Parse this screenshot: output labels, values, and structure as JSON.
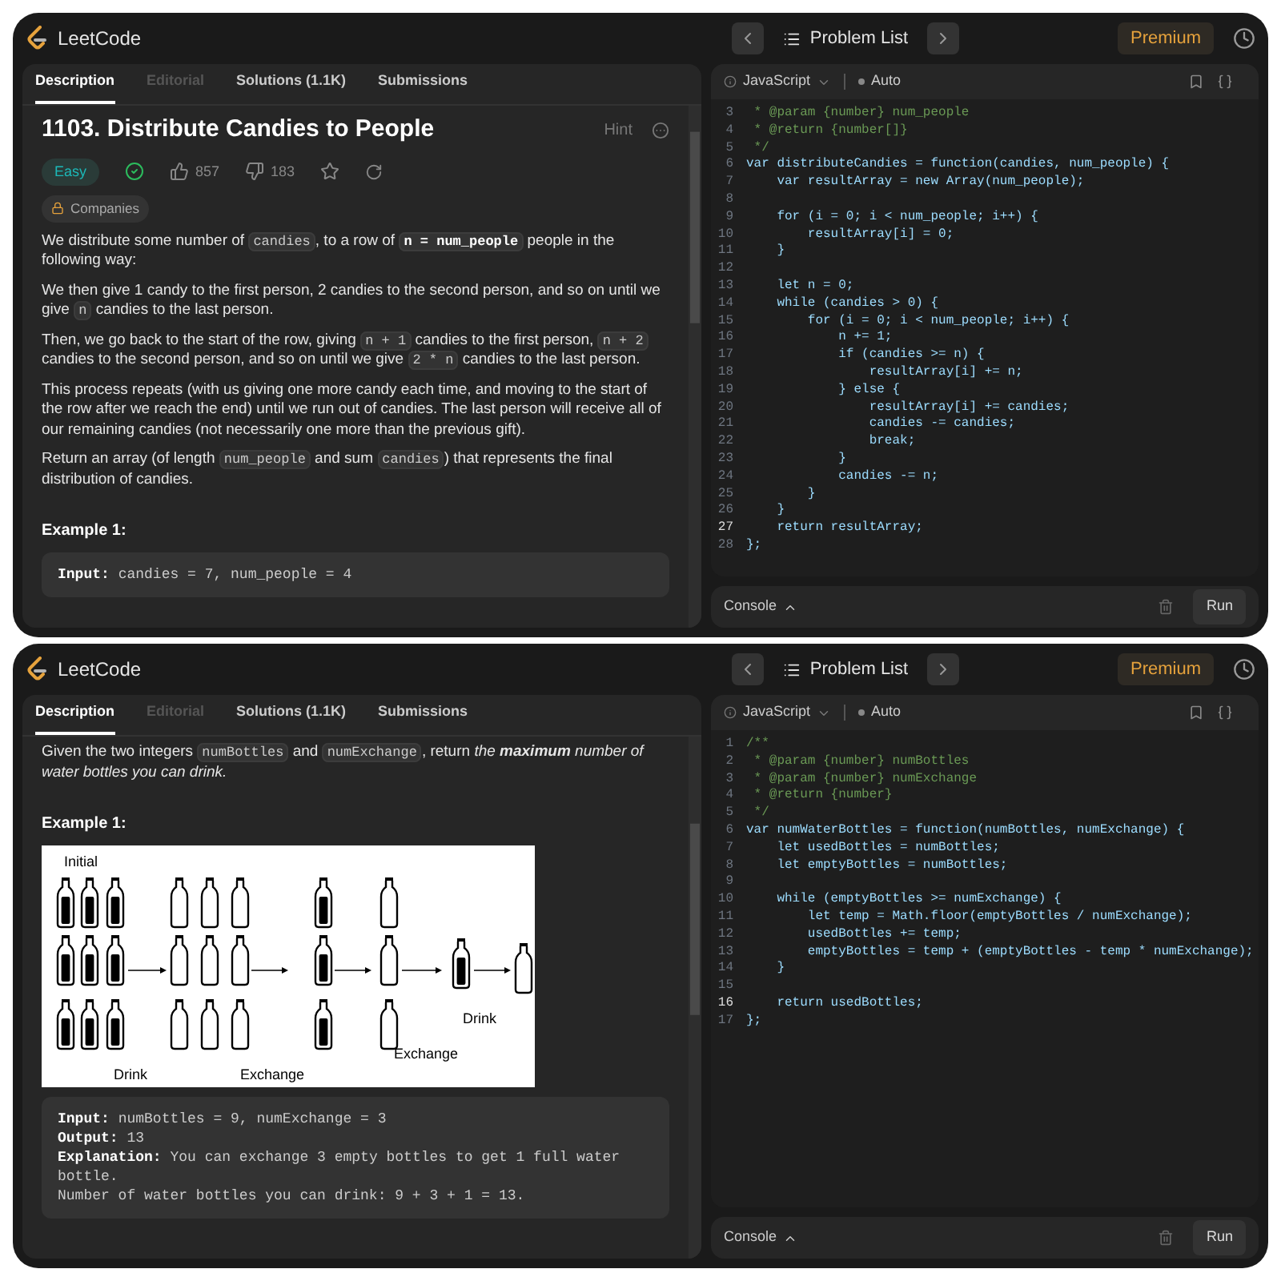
{
  "windows": [
    {
      "header": {
        "logo": "LeetCode",
        "problem_list": "Problem List",
        "premium": "Premium"
      },
      "tabs": [
        {
          "label": "Description",
          "selected": true,
          "disabled": false
        },
        {
          "label": "Editorial",
          "selected": false,
          "disabled": true
        },
        {
          "label": "Solutions (1.1K)",
          "selected": false,
          "disabled": false
        },
        {
          "label": "Submissions",
          "selected": false,
          "disabled": false
        }
      ],
      "problem": {
        "title": "1103. Distribute Candies to People",
        "hint": "Hint",
        "difficulty": "Easy",
        "solved": true,
        "likes": "857",
        "dislikes": "183",
        "companies": "Companies"
      },
      "description": [
        {
          "kind": "paragraph",
          "segments": [
            {
              "kind": "text",
              "text": "We distribute some number of "
            },
            {
              "kind": "code",
              "text": "candies"
            },
            {
              "kind": "text",
              "text": ", to a row of "
            },
            {
              "kind": "strongcode",
              "text": "n = num_people"
            },
            {
              "kind": "text",
              "text": " people in the following way:"
            }
          ]
        },
        {
          "kind": "paragraph",
          "segments": [
            {
              "kind": "text",
              "text": "We then give 1 candy to the first person, 2 candies to the second person, and so on until we give "
            },
            {
              "kind": "code",
              "text": "n"
            },
            {
              "kind": "text",
              "text": " candies to the last person."
            }
          ]
        },
        {
          "kind": "paragraph",
          "segments": [
            {
              "kind": "text",
              "text": "Then, we go back to the start of the row, giving "
            },
            {
              "kind": "code",
              "text": "n + 1"
            },
            {
              "kind": "text",
              "text": " candies to the first person, "
            },
            {
              "kind": "code",
              "text": "n + 2"
            },
            {
              "kind": "text",
              "text": " candies to the second person, and so on until we give "
            },
            {
              "kind": "code",
              "text": "2 * n"
            },
            {
              "kind": "text",
              "text": " candies to the last person."
            }
          ]
        },
        {
          "kind": "paragraph",
          "segments": [
            {
              "kind": "text",
              "text": "This process repeats (with us giving one more candy each time, and moving to the start of the row after we reach the end) until we run out of candies.  The last person will receive all of our remaining candies (not necessarily one more than the previous gift)."
            }
          ]
        },
        {
          "kind": "paragraph",
          "segments": [
            {
              "kind": "text",
              "text": "Return an array (of length "
            },
            {
              "kind": "code",
              "text": "num_people"
            },
            {
              "kind": "text",
              "text": " and sum "
            },
            {
              "kind": "code",
              "text": "candies"
            },
            {
              "kind": "text",
              "text": ") that represents the final distribution of candies."
            }
          ]
        },
        {
          "kind": "heading",
          "text": "Example 1:"
        },
        {
          "kind": "example",
          "lines": [
            {
              "label": "Input:",
              "value": "candies = 7, num_people = 4"
            }
          ]
        }
      ],
      "editor": {
        "language": "JavaScript",
        "mode": "Auto",
        "lines": [
          {
            "number": "3",
            "kind": "comment",
            "text": " * @param {number} num_people",
            "current": false
          },
          {
            "number": "4",
            "kind": "comment",
            "text": " * @return {number[]}",
            "current": false
          },
          {
            "number": "5",
            "kind": "comment",
            "text": " */",
            "current": false
          },
          {
            "number": "6",
            "kind": "code",
            "text": "var distributeCandies = function(candies, num_people) {",
            "current": false
          },
          {
            "number": "7",
            "kind": "code",
            "text": "    var resultArray = new Array(num_people);",
            "current": false
          },
          {
            "number": "8",
            "kind": "code",
            "current": false
          },
          {
            "number": "9",
            "kind": "code",
            "text": "    for (i = 0; i < num_people; i++) {",
            "current": false
          },
          {
            "number": "10",
            "kind": "code",
            "text": "        resultArray[i] = 0;",
            "current": false
          },
          {
            "number": "11",
            "kind": "code",
            "text": "    }",
            "current": false
          },
          {
            "number": "12",
            "kind": "code",
            "current": false
          },
          {
            "number": "13",
            "kind": "code",
            "text": "    let n = 0;",
            "current": false
          },
          {
            "number": "14",
            "kind": "code",
            "text": "    while (candies > 0) {",
            "current": false
          },
          {
            "number": "15",
            "kind": "code",
            "text": "        for (i = 0; i < num_people; i++) {",
            "current": false
          },
          {
            "number": "16",
            "kind": "code",
            "text": "            n += 1;",
            "current": false
          },
          {
            "number": "17",
            "kind": "code",
            "text": "            if (candies >= n) {",
            "current": false
          },
          {
            "number": "18",
            "kind": "code",
            "text": "                resultArray[i] += n;",
            "current": false
          },
          {
            "number": "19",
            "kind": "code",
            "text": "            } else {",
            "current": false
          },
          {
            "number": "20",
            "kind": "code",
            "text": "                resultArray[i] += candies;",
            "current": false
          },
          {
            "number": "21",
            "kind": "code",
            "text": "                candies -= candies;",
            "current": false
          },
          {
            "number": "22",
            "kind": "code",
            "text": "                break;",
            "current": false
          },
          {
            "number": "23",
            "kind": "code",
            "text": "            }",
            "current": false
          },
          {
            "number": "24",
            "kind": "code",
            "text": "            candies -= n;",
            "current": false
          },
          {
            "number": "25",
            "kind": "code",
            "text": "        }",
            "current": false
          },
          {
            "number": "26",
            "kind": "code",
            "text": "    }",
            "current": false
          },
          {
            "number": "27",
            "kind": "code",
            "text": "    return resultArray;",
            "current": true
          },
          {
            "number": "28",
            "kind": "code",
            "text": "};",
            "current": false
          }
        ]
      },
      "console": {
        "label": "Console",
        "run": "Run"
      }
    },
    {
      "header": {
        "logo": "LeetCode",
        "problem_list": "Problem List",
        "premium": "Premium"
      },
      "tabs": [
        {
          "label": "Description",
          "selected": true,
          "disabled": false
        },
        {
          "label": "Editorial",
          "selected": false,
          "disabled": true
        },
        {
          "label": "Solutions (1.1K)",
          "selected": false,
          "disabled": false
        },
        {
          "label": "Submissions",
          "selected": false,
          "disabled": false
        }
      ],
      "description": [
        {
          "kind": "paragraph",
          "segments": [
            {
              "kind": "text",
              "text": "Given the two integers "
            },
            {
              "kind": "code",
              "text": "numBottles"
            },
            {
              "kind": "text",
              "text": " and "
            },
            {
              "kind": "code",
              "text": "numExchange"
            },
            {
              "kind": "text",
              "text": ", return "
            },
            {
              "kind": "em",
              "text": "the **maximum** number of water bottles you can drink."
            }
          ]
        },
        {
          "kind": "heading",
          "text": "Example 1:"
        },
        {
          "kind": "diagram",
          "labels": [
            "Initial",
            "Drink",
            "Exchange",
            "Exchange",
            "Drink"
          ]
        },
        {
          "kind": "example",
          "lines": [
            {
              "label": "Input:",
              "value": "numBottles = 9, numExchange = 3"
            },
            {
              "label": "Output:",
              "value": "13"
            },
            {
              "label": "Explanation:",
              "value": "You can exchange 3 empty bottles to get 1 full water bottle."
            },
            {
              "value": "Number of water bottles you can drink: 9 + 3 + 1 = 13."
            }
          ]
        }
      ],
      "editor": {
        "language": "JavaScript",
        "mode": "Auto",
        "lines": [
          {
            "number": "1",
            "kind": "comment",
            "text": "/**",
            "current": false
          },
          {
            "number": "2",
            "kind": "comment",
            "text": " * @param {number} numBottles",
            "current": false
          },
          {
            "number": "3",
            "kind": "comment",
            "text": " * @param {number} numExchange",
            "current": false
          },
          {
            "number": "4",
            "kind": "comment",
            "text": " * @return {number}",
            "current": false
          },
          {
            "number": "5",
            "kind": "comment",
            "text": " */",
            "current": false
          },
          {
            "number": "6",
            "kind": "code",
            "text": "var numWaterBottles = function(numBottles, numExchange) {",
            "current": false
          },
          {
            "number": "7",
            "kind": "code",
            "text": "    let usedBottles = numBottles;",
            "current": false
          },
          {
            "number": "8",
            "kind": "code",
            "text": "    let emptyBottles = numBottles;",
            "current": false
          },
          {
            "number": "9",
            "kind": "code",
            "current": false
          },
          {
            "number": "10",
            "kind": "code",
            "text": "    while (emptyBottles >= numExchange) {",
            "current": false
          },
          {
            "number": "11",
            "kind": "code",
            "text": "        let temp = Math.floor(emptyBottles / numExchange);",
            "current": false
          },
          {
            "number": "12",
            "kind": "code",
            "text": "        usedBottles += temp;",
            "current": false
          },
          {
            "number": "13",
            "kind": "code",
            "text": "        emptyBottles = temp + (emptyBottles - temp * numExchange);",
            "current": false
          },
          {
            "number": "14",
            "kind": "code",
            "text": "    }",
            "current": false
          },
          {
            "number": "15",
            "kind": "code",
            "current": false
          },
          {
            "number": "16",
            "kind": "code",
            "text": "    return usedBottles;",
            "current": true
          },
          {
            "number": "17",
            "kind": "code",
            "text": "};",
            "current": false
          }
        ]
      },
      "console": {
        "label": "Console",
        "run": "Run"
      }
    }
  ]
}
